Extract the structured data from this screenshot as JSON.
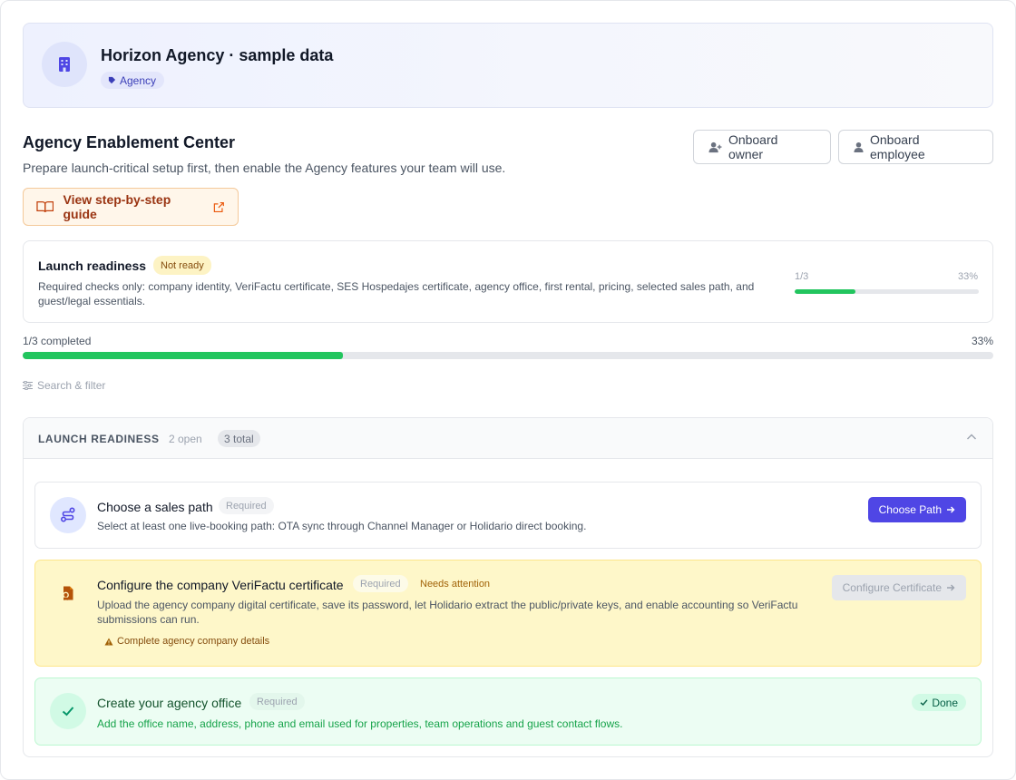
{
  "agency": {
    "name": "Horizon Agency · sample data",
    "badge": "Agency"
  },
  "page": {
    "title": "Agency Enablement Center",
    "subtitle": "Prepare launch-critical setup first, then enable the Agency features your team will use.",
    "guide_label": "View step-by-step guide",
    "onboard_owner_label": "Onboard owner",
    "onboard_employee_label": "Onboard employee"
  },
  "readiness": {
    "title": "Launch readiness",
    "status": "Not ready",
    "description": "Required checks only: company identity, VeriFactu certificate, SES Hospedajes certificate, agency office, first rental, pricing, selected sales path, and guest/legal essentials.",
    "count": "1/3",
    "percent_label": "33%",
    "percent": 33
  },
  "overall": {
    "label": "1/3 completed",
    "percent_label": "33%",
    "percent": 33
  },
  "filter_label": "Search & filter",
  "section": {
    "title": "LAUNCH READINESS",
    "open": "2 open",
    "total": "3 total"
  },
  "tasks": [
    {
      "title": "Choose a sales path",
      "required": "Required",
      "description": "Select at least one live-booking path: OTA sync through Channel Manager or Holidario direct booking.",
      "action": "Choose Path",
      "icon": "route-icon"
    },
    {
      "title": "Configure the company VeriFactu certificate",
      "required": "Required",
      "status": "Needs attention",
      "description": "Upload the agency company digital certificate, save its password, let Holidario extract the public/private keys, and enable accounting so VeriFactu submissions can run.",
      "warning": "Complete agency company details",
      "action": "Configure Certificate",
      "icon": "certificate-icon"
    },
    {
      "title": "Create your agency office",
      "required": "Required",
      "description": "Add the office name, address, phone and email used for properties, team operations and guest contact flows.",
      "status": "Done",
      "icon": "check-icon"
    }
  ],
  "colors": {
    "accent": "#4f46e5",
    "success": "#22c55e",
    "warning_bg": "#fef7c9",
    "done_bg": "#ecfdf3"
  }
}
